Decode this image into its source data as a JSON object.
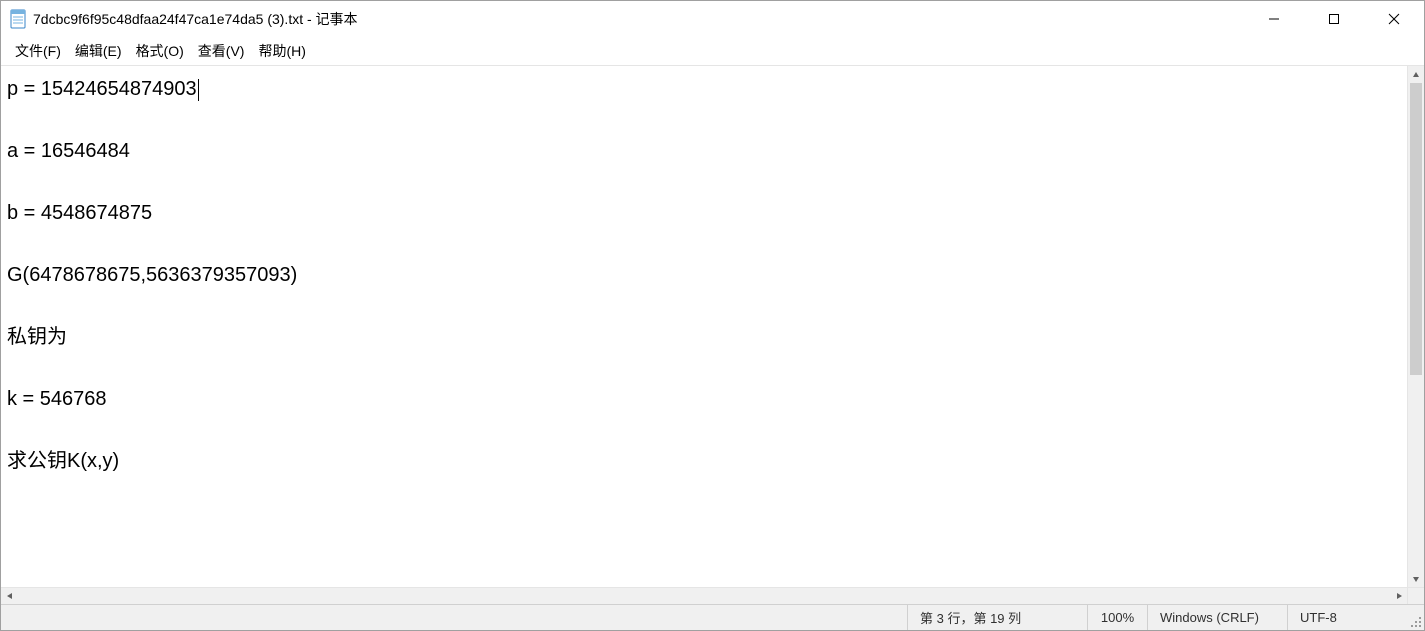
{
  "titlebar": {
    "title": "7dcbc9f6f95c48dfaa24f47ca1e74da5 (3).txt - 记事本"
  },
  "menubar": {
    "file": "文件(F)",
    "edit": "编辑(E)",
    "format": "格式(O)",
    "view": "查看(V)",
    "help": "帮助(H)"
  },
  "content": {
    "line1": "p = 15424654874903",
    "line2": "a = 16546484",
    "line3": "b = 4548674875",
    "line4": "G(6478678675,5636379357093)",
    "line5": "私钥为",
    "line6": "k = 546768",
    "line7": "求公钥K(x,y)"
  },
  "statusbar": {
    "cursor": "第 3 行，第 19 列",
    "zoom": "100%",
    "eol": "Windows (CRLF)",
    "encoding": "UTF-8"
  }
}
